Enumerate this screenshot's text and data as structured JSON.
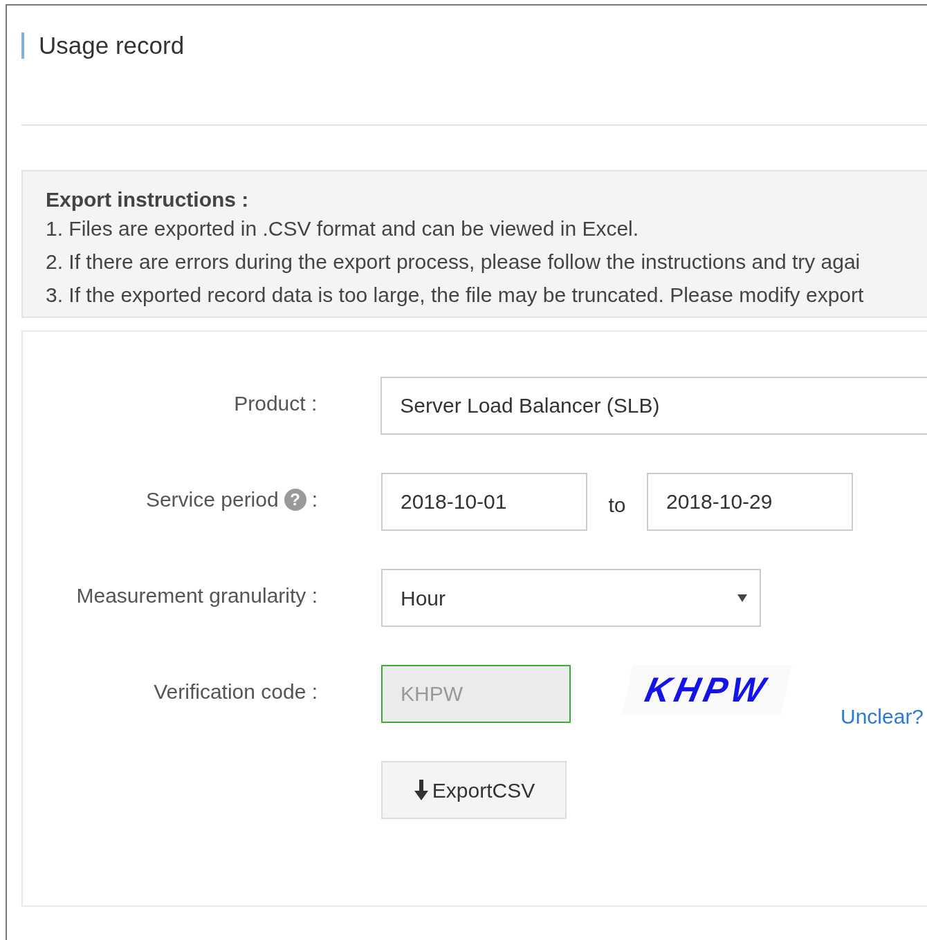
{
  "title": "Usage record",
  "instructions": {
    "heading": "Export instructions :",
    "lines": [
      "1. Files are exported in .CSV format and can be viewed in Excel.",
      "2. If there are errors during the export process, please follow the instructions and try agai",
      "3. If the exported record data is too large, the file may be truncated. Please modify export"
    ]
  },
  "form": {
    "product": {
      "label": "Product :",
      "value": "Server Load Balancer (SLB)"
    },
    "period": {
      "label": "Service period",
      "help": "?",
      "colon": ":",
      "from": "2018-10-01",
      "separator": "to",
      "to": "2018-10-29"
    },
    "granularity": {
      "label": "Measurement granularity :",
      "value": "Hour"
    },
    "verification": {
      "label": "Verification code :",
      "placeholder": "KHPW",
      "valid": true,
      "captcha": "KHPW",
      "refresh_link": "Unclear?"
    },
    "export_button": "ExportCSV"
  }
}
